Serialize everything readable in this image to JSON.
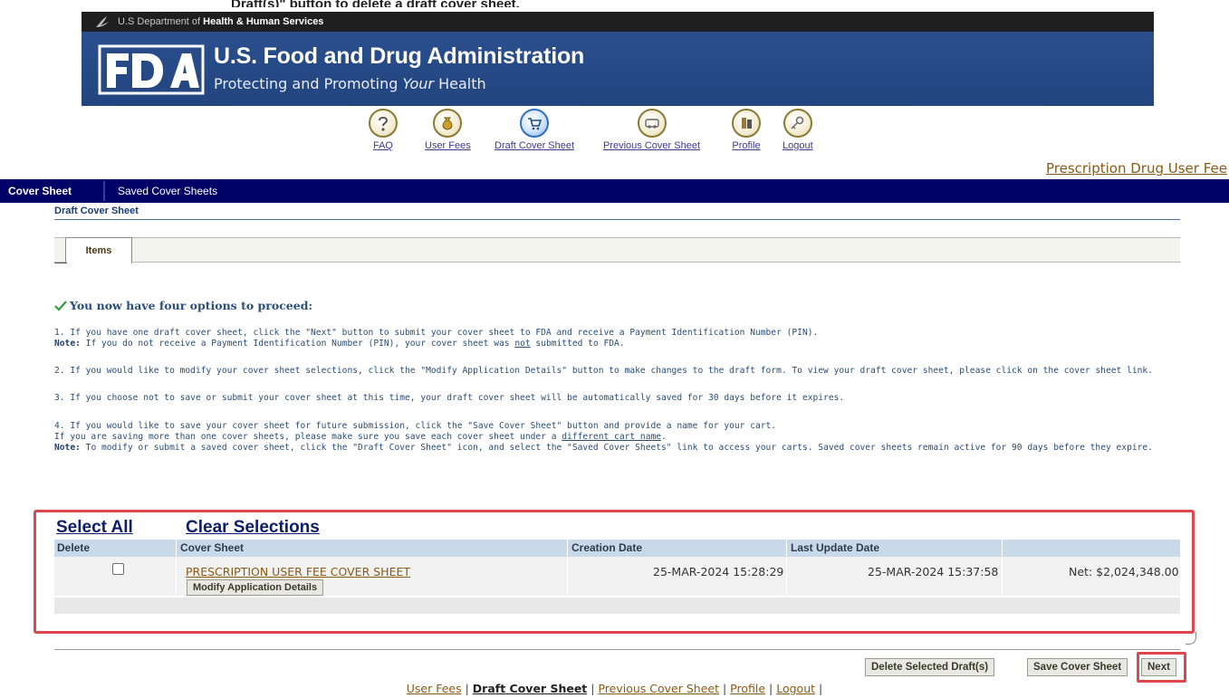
{
  "cropped_top_text": "Draft(s)\" button to delete a draft cover sheet.",
  "banner": {
    "dept_prefix": "U.S Department of",
    "dept_name": "Health & Human Services",
    "title": "U.S. Food and Drug Administration",
    "tagline_pre": "Protecting and Promoting",
    "tagline_em": "Your",
    "tagline_post": "Health"
  },
  "nav": [
    {
      "label": "FAQ",
      "icon": "question-icon"
    },
    {
      "label": "User Fees",
      "icon": "money-bag-icon"
    },
    {
      "label": "Draft Cover Sheet",
      "icon": "cart-icon"
    },
    {
      "label": "Previous Cover Sheet",
      "icon": "truck-icon"
    },
    {
      "label": "Profile",
      "icon": "profile-icon"
    },
    {
      "label": "Logout",
      "icon": "logout-icon"
    }
  ],
  "pdufa_link": "Prescription Drug User Fee",
  "tabs": {
    "active": "Cover Sheet",
    "second": "Saved Cover Sheets"
  },
  "section_title": "Draft Cover Sheet",
  "subtab": "Items",
  "success_message": "You now have four options to proceed:",
  "instructions": {
    "s1": "1. If you have one draft cover sheet, click the \"Next\" button to submit your cover sheet to FDA and receive a Payment Identification Number (PIN).",
    "n1_label": "Note:",
    "n1_pre": "If you do not receive a Payment Identification Number (PIN), your cover sheet was",
    "n1_under": "not",
    "n1_post": "submitted to FDA.",
    "s2": "2. If you would like to modify your cover sheet selections, click the \"Modify Application Details\" button to make changes to the draft form. To view your draft cover sheet, please click on the cover sheet link.",
    "s3": "3. If you choose not to save or submit your cover sheet at this time, your draft cover sheet will be automatically saved for 30 days before it expires.",
    "s4": "4. If you would like to save your cover sheet for future submission, click the \"Save Cover Sheet\" button and provide a name for your cart.",
    "s4b_pre": "If you are saving more than one cover sheets, please make sure you save each cover sheet under a",
    "s4b_link": "different cart name",
    "s4b_post": ".",
    "n2_label": "Note:",
    "n2_text": "To modify or submit a saved cover sheet, click the \"Draft Cover Sheet\" icon, and select the \"Saved Cover Sheets\" link to access your carts. Saved cover sheets remain active for 90 days before they expire."
  },
  "table": {
    "select_all": "Select All",
    "clear_selections": "Clear Selections",
    "headers": [
      "Delete",
      "Cover Sheet",
      "Creation Date",
      "Last Update Date",
      ""
    ],
    "rows": [
      {
        "checked": false,
        "cover_sheet": "PRESCRIPTION USER FEE COVER SHEET",
        "modify_label": "Modify Application Details",
        "creation_date": "25-MAR-2024 15:28:29",
        "last_update": "25-MAR-2024 15:37:58",
        "net": "Net: $2,024,348.00"
      }
    ]
  },
  "buttons": {
    "delete": "Delete Selected Draft(s)",
    "save": "Save Cover Sheet",
    "next": "Next"
  },
  "footer": {
    "user_fees": "User Fees",
    "draft": "Draft Cover Sheet",
    "previous": "Previous Cover Sheet",
    "profile": "Profile",
    "logout": "Logout",
    "sep": "|"
  },
  "colors": {
    "banner_blue": "#22457f",
    "tabbar_navy": "#000066",
    "link_brown": "#8b5a14",
    "highlight_red": "#e0474c",
    "header_blue": "#c9d9ea"
  }
}
